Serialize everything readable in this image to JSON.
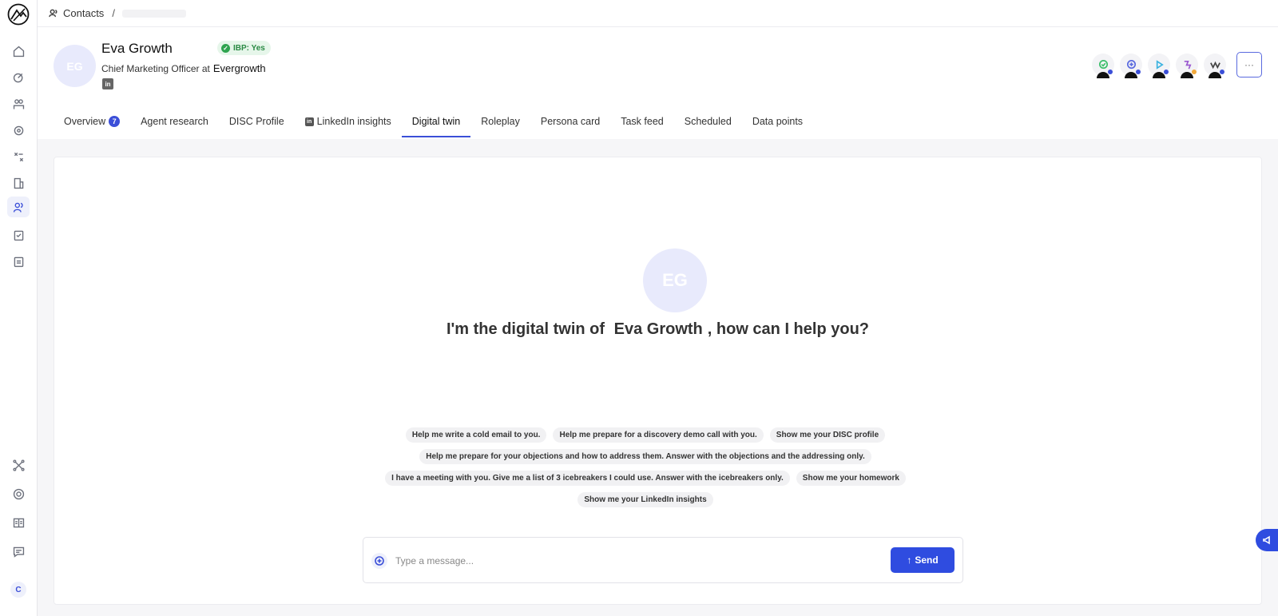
{
  "breadcrumb": {
    "section": "Contacts",
    "separator": "/"
  },
  "contact": {
    "initials": "EG",
    "name": "Eva Growth",
    "ibp_label": "IBP: Yes",
    "role_prefix": "Chief Marketing Officer at",
    "company": "Evergrowth",
    "linkedin_icon": "in"
  },
  "header": {
    "more_label": "···"
  },
  "tabs": [
    {
      "label": "Overview",
      "badge": "7"
    },
    {
      "label": "Agent research"
    },
    {
      "label": "DISC Profile"
    },
    {
      "label": "LinkedIn insights",
      "icon": "in"
    },
    {
      "label": "Digital twin",
      "active": true
    },
    {
      "label": "Roleplay"
    },
    {
      "label": "Persona card"
    },
    {
      "label": "Task feed"
    },
    {
      "label": "Scheduled"
    },
    {
      "label": "Data points"
    }
  ],
  "twin": {
    "initials": "EG",
    "greeting_prefix": "I'm the digital twin of",
    "greeting_name": "Eva Growth",
    "greeting_suffix": ", how can I help you?"
  },
  "suggestions": [
    "Help me write a cold email to you.",
    "Help me prepare for a discovery demo call with you.",
    "Show me your DISC profile",
    "Help me prepare for your objections and how to address them. Answer with the objections and the addressing only.",
    "I have a meeting with you. Give me a list of 3 icebreakers I could use. Answer with the icebreakers only.",
    "Show me your homework",
    "Show me your LinkedIn insights"
  ],
  "composer": {
    "placeholder": "Type a message...",
    "send_label": "Send",
    "send_icon": "↑"
  },
  "user": {
    "initial": "C"
  },
  "colors": {
    "accent": "#2f4ce0",
    "ibp_bg": "#e6f6ea",
    "ibp_text": "#2a8a44"
  }
}
